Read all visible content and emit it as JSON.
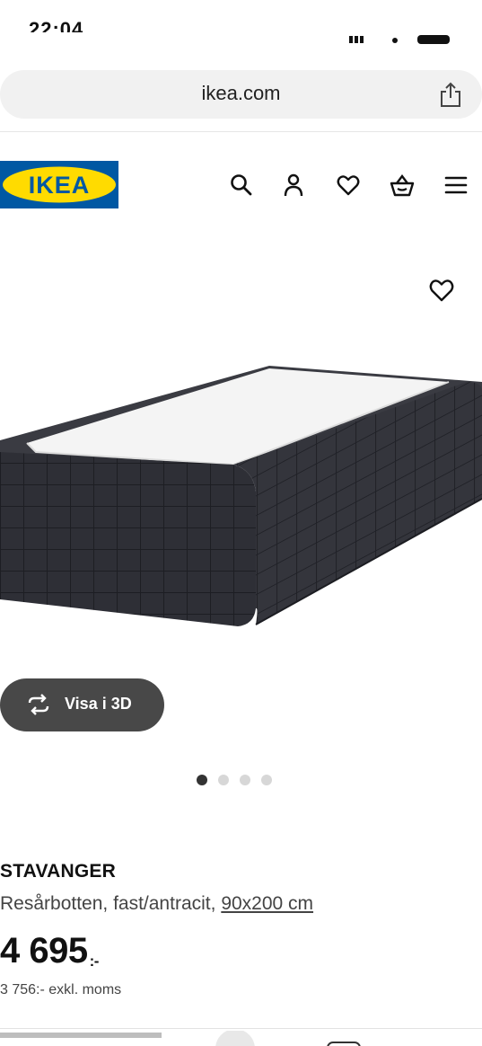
{
  "status_bar": {
    "time": "22:04"
  },
  "browser": {
    "url": "ikea.com"
  },
  "header": {
    "logo_text": "IKEA",
    "icons": [
      "search-icon",
      "user-icon",
      "heart-icon",
      "basket-icon",
      "menu-icon"
    ]
  },
  "product": {
    "name": "STAVANGER",
    "description": "Resårbotten, fast/antracit,",
    "size_link": "90x200 cm",
    "price": "4 695",
    "price_suffix": ":-",
    "price_ex_vat": "3 756:- exkl. moms",
    "view_3d_label": "Visa i 3D",
    "image_count": 4,
    "active_image": 1
  },
  "colors": {
    "ikea_blue": "#0058a3",
    "ikea_yellow": "#ffdb00",
    "dark_button": "#484848",
    "fabric": "#2e2f36"
  }
}
